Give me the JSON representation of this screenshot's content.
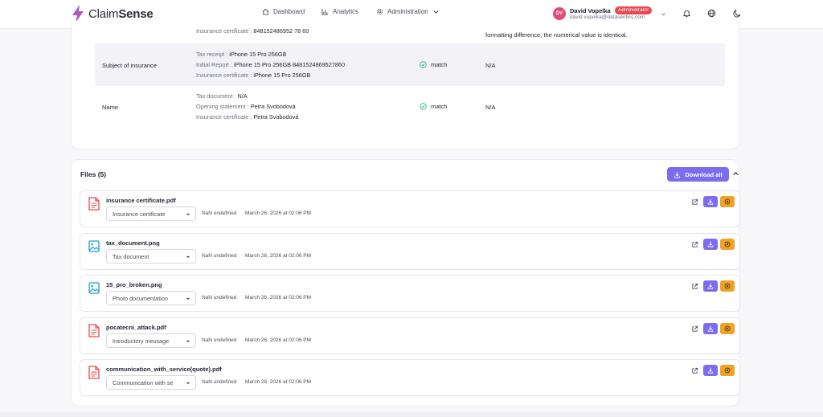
{
  "app": {
    "name_part1": "Claim",
    "name_part2": "Sense",
    "brand_color": "#7c6cf0"
  },
  "nav": [
    {
      "label": "Dashboard",
      "icon": "home-icon"
    },
    {
      "label": "Analytics",
      "icon": "bar-chart-icon"
    },
    {
      "label": "Administration",
      "icon": "gear-icon"
    }
  ],
  "user": {
    "initials": "DV",
    "name": "David Vopelka",
    "role": "Administrator",
    "email": "david.vopelka@datasentics.com"
  },
  "comparison": {
    "partial_top": {
      "source_line": {
        "key": "Insurance certificate : ",
        "value": "848152486952 78 60"
      },
      "note": "formatting difference; the numerical value is identical."
    },
    "rows": [
      {
        "label": "Subject of insurance",
        "sources": [
          {
            "key": "Tax receipt : ",
            "value": "iPhone 15 Pro 256GB"
          },
          {
            "key": "Initial Report : ",
            "value": "iPhone 15 Pro 256GB 8481524869527860"
          },
          {
            "key": "Insurance certificate : ",
            "value": "iPhone 15 Pro 256GB"
          }
        ],
        "status": "match",
        "note": "N/A"
      },
      {
        "label": "Name",
        "sources": [
          {
            "key": "Tax document : ",
            "value": "N/A"
          },
          {
            "key": "Opening statement : ",
            "value": "Petra Svobodová"
          },
          {
            "key": "Insurance certificate : ",
            "value": "Petra Svobodová"
          }
        ],
        "status": "match",
        "note": "N/A"
      }
    ]
  },
  "files": {
    "title": "Files (5)",
    "download_all_label": "Download all",
    "items": [
      {
        "name": "insurance certificate.pdf",
        "kind": "pdf-file-icon",
        "type": "Insurance certificate",
        "size": "NaN undefined",
        "date": "March 26, 2026 at 02:06 PM"
      },
      {
        "name": "tax_document.png",
        "kind": "image-file-icon",
        "type": "Tax document",
        "size": "NaN undefined",
        "date": "March 26, 2026 at 02:06 PM"
      },
      {
        "name": "15_pro_broken.png",
        "kind": "image-file-icon",
        "type": "Photo documentation",
        "size": "NaN undefined",
        "date": "March 26, 2026 at 02:06 PM"
      },
      {
        "name": "pocatecni_attack.pdf",
        "kind": "pdf-file-icon",
        "type": "Introductory message",
        "size": "NaN undefined",
        "date": "March 26, 2026 at 02:06 PM"
      },
      {
        "name": "communication_with_service(quote).pdf",
        "kind": "pdf-file-icon",
        "type": "Communication with se",
        "size": "NaN undefined",
        "date": "March 26, 2026 at 02:06 PM"
      }
    ]
  },
  "colors": {
    "primary": "#7c6cf0",
    "warning": "#f0a224",
    "pdf": "#e5484d",
    "image": "#1a9fd8",
    "match": "#2bb37a",
    "badge": "#e5484d",
    "avatar": "#e5497a"
  }
}
